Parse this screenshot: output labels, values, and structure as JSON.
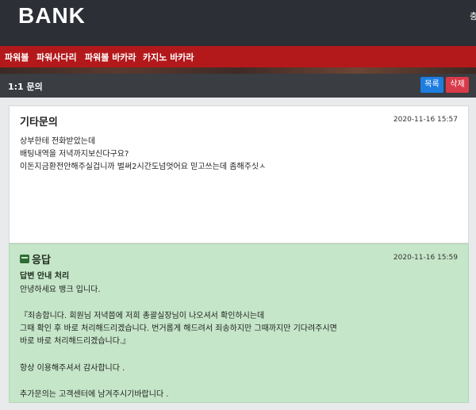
{
  "header": {
    "logo": "BANK",
    "right_text": "충"
  },
  "nav": {
    "items": [
      "파워볼",
      "파워사다리",
      "파워볼 바카라",
      "카지노 바카라"
    ]
  },
  "titlebar": {
    "title": "1:1 문의",
    "list_button": "목록",
    "delete_button": "삭제"
  },
  "inquiry": {
    "title": "기타문의",
    "date": "2020-11-16 15:57",
    "lines": [
      "상부한테 전화받았는데",
      "배팅내역을 저녁까지보신다구요?",
      "이돈지금환전안해주실겁니까 벌써2시간도넘엇어요 믿고쓰는데 좀해주싯ㅅ"
    ]
  },
  "answer": {
    "heading": "응답",
    "date": "2020-11-16 15:59",
    "subheading": "답변 안내 처리",
    "lines": [
      "안녕하세요 뱅크 입니다.",
      "『죄송합니다. 회원님 저녁쯤에 저희 총괄실장님이 나오셔서 확인하시는데",
      "그때 확인 후 바로 처리해드리겠습니다. 번거롭게 해드려서 죄송하지만 그때까지만 기다려주시면",
      "바로 바로 처리해드리겠습니다.』",
      "항상 이용해주셔서 감사합니다 .",
      "추가문의는 고객센터에 남겨주시기바랍니다 ."
    ]
  },
  "colors": {
    "topbar": "#2c2f35",
    "nav": "#b3191b",
    "list_button": "#1e7ee0",
    "delete_button": "#d93a4a",
    "answer_bg": "#c5e6c8"
  }
}
